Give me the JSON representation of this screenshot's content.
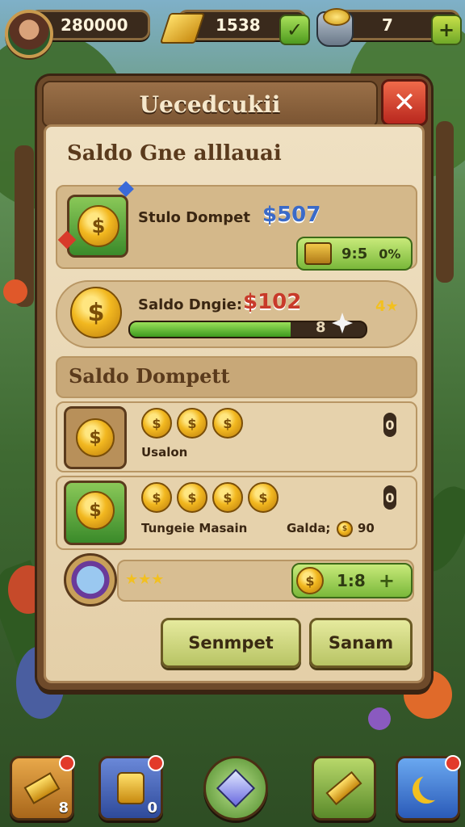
{
  "hud": {
    "coins": "280000",
    "bars": "1538",
    "gems": "7",
    "plus": "+"
  },
  "panel": {
    "title": "Uecedcukii",
    "close": "✕",
    "heading1": "Saldo Gne alllauai",
    "card1": {
      "label": "Stulo Dompet",
      "amount": "$507",
      "pill_a": "9:5",
      "pill_b": "0%"
    },
    "card2": {
      "label": "Saldo Dngie:",
      "amount": "$102",
      "stars": "4★",
      "bar_count": "8",
      "progress": 0.68
    },
    "heading2": "Saldo Dompett",
    "list": [
      {
        "caption": "Usalon",
        "count": "0",
        "coins": 3
      },
      {
        "caption": "Tungeie Masain",
        "extra": "Galda;",
        "extra_val": "90",
        "count": "0",
        "coins": 4
      }
    ],
    "reward": {
      "stars": "★★★",
      "value": "1:8",
      "plus": "+"
    },
    "buttons": {
      "left": "Senmpet",
      "right": "Sanam"
    }
  },
  "nav": [
    {
      "icon": "gold-bar-icon",
      "count": "8"
    },
    {
      "icon": "treasure-jar-icon",
      "count": "0"
    },
    {
      "icon": "gem-icon",
      "count": ""
    },
    {
      "icon": "sword-icon",
      "count": ""
    },
    {
      "icon": "crescent-icon",
      "count": ""
    }
  ],
  "colors": {
    "panel_wood": "#6e4a2a",
    "parchment": "#efe0c2",
    "amount_blue": "#3a6ac8",
    "amount_red": "#c83a2a"
  }
}
